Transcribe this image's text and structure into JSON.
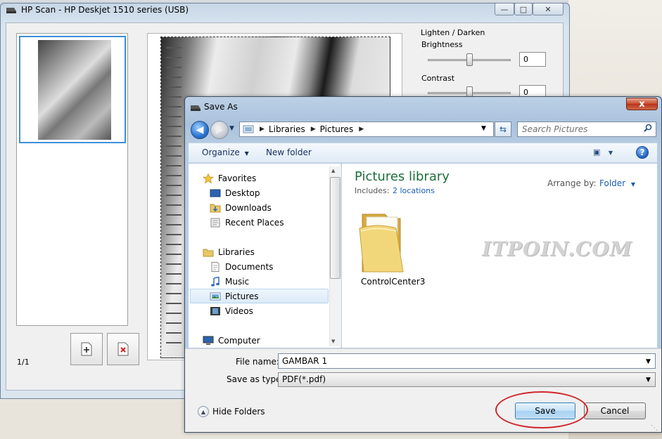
{
  "hp_window": {
    "title": "HP Scan - HP Deskjet 1510 series (USB)",
    "page_count": "1/1",
    "adjust": {
      "group_label": "Lighten / Darken",
      "brightness_label": "Brightness",
      "brightness_value": "0",
      "contrast_label": "Contrast",
      "contrast_value": "0"
    }
  },
  "dialog": {
    "title": "Save As",
    "close_glyph": "x",
    "address": {
      "crumbs": [
        "Libraries",
        "Pictures"
      ]
    },
    "search": {
      "placeholder": "Search Pictures"
    },
    "toolbar": {
      "organize": "Organize",
      "new_folder": "New folder",
      "help": "?"
    },
    "nav": {
      "favorites": "Favorites",
      "desktop": "Desktop",
      "downloads": "Downloads",
      "recent": "Recent Places",
      "libraries": "Libraries",
      "documents": "Documents",
      "music": "Music",
      "pictures": "Pictures",
      "videos": "Videos",
      "computer": "Computer"
    },
    "library": {
      "title": "Pictures library",
      "includes_label": "Includes:",
      "includes_link": "2 locations",
      "arrange_label": "Arrange by:",
      "arrange_value": "Folder"
    },
    "items": [
      {
        "name": "ControlCenter3"
      }
    ],
    "file_name_label": "File name:",
    "file_name_value": "GAMBAR 1",
    "save_type_label": "Save as type:",
    "save_type_value": "PDF(*.pdf)",
    "hide_folders": "Hide Folders",
    "save_button": "Save",
    "cancel_button": "Cancel"
  },
  "watermark": "ITPOIN.COM",
  "colors": {
    "library_title": "#1e6d3b",
    "link": "#1a5fb4",
    "highlight": "#d0262a"
  }
}
